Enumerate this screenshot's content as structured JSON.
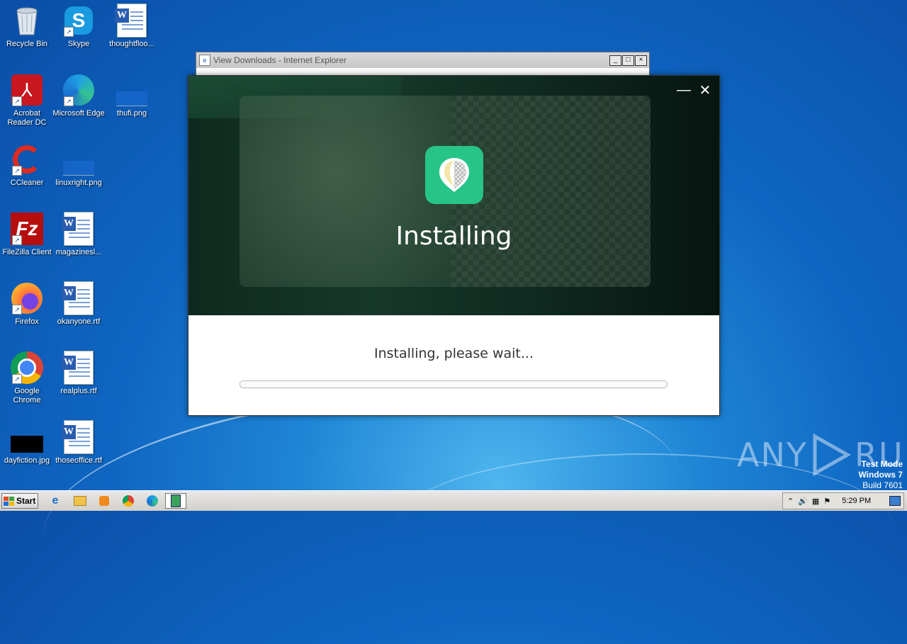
{
  "desktop": {
    "icons": [
      {
        "label": "Recycle Bin",
        "icon": "recycle-bin-icon"
      },
      {
        "label": "Skype",
        "icon": "skype-icon"
      },
      {
        "label": "thoughtfloo...",
        "icon": "word-doc-icon"
      },
      {
        "label": "Acrobat Reader DC",
        "icon": "acrobat-icon"
      },
      {
        "label": "Microsoft Edge",
        "icon": "edge-icon"
      },
      {
        "label": "thufi.png",
        "icon": "image-file-icon"
      },
      {
        "label": "CCleaner",
        "icon": "ccleaner-icon"
      },
      {
        "label": "linuxright.png",
        "icon": "image-file-icon"
      },
      {
        "label": "FileZilla Client",
        "icon": "filezilla-icon"
      },
      {
        "label": "magazinesl...",
        "icon": "word-doc-icon"
      },
      {
        "label": "Firefox",
        "icon": "firefox-icon"
      },
      {
        "label": "okanyone.rtf",
        "icon": "word-doc-icon"
      },
      {
        "label": "Google Chrome",
        "icon": "chrome-icon"
      },
      {
        "label": "realplus.rtf",
        "icon": "word-doc-icon"
      },
      {
        "label": "dayfiction.jpg",
        "icon": "image-file-icon"
      },
      {
        "label": "thoseoffice.rtf",
        "icon": "word-doc-icon"
      }
    ]
  },
  "ie_window": {
    "title": "View Downloads - Internet Explorer",
    "min": "_",
    "max": "□",
    "close": "×"
  },
  "installer": {
    "heading": "Installing",
    "status": "Installing, please wait...",
    "progress": 0,
    "min": "—",
    "close": "✕",
    "accent": "#27c488"
  },
  "watermark": {
    "brand_left": "ANY",
    "brand_right": "RUN",
    "mode": "Test Mode",
    "os": "Windows 7",
    "build": "Build 7601"
  },
  "taskbar": {
    "start_label": "Start",
    "clock": "5:29 PM"
  }
}
